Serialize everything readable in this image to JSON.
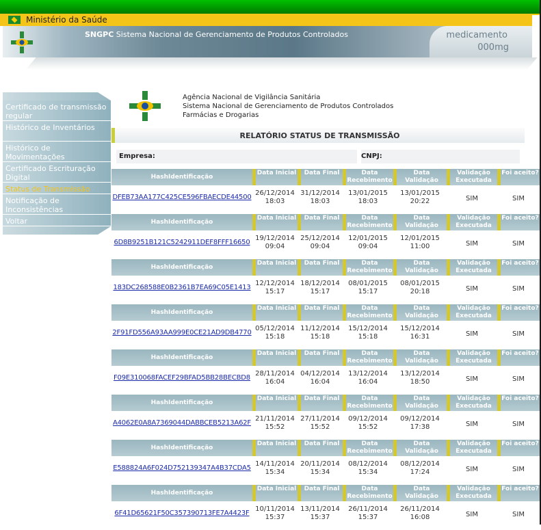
{
  "ministry": {
    "title": "Ministério da Saúde"
  },
  "banner": {
    "system_abbr": "SNGPC",
    "system_name": "Sistema Nacional de Gerenciamento de Produtos Controlados",
    "product_line1": "medicamento",
    "product_line2": "000mg"
  },
  "sidebar": {
    "items": [
      {
        "label": "Certificado de transmissão regular",
        "active": false
      },
      {
        "label": "Histórico de Inventários",
        "active": false
      },
      {
        "label": "Histórico de Movimentações",
        "active": false
      },
      {
        "label": "Certificado Escrituração Digital",
        "active": false
      },
      {
        "label": "Status de Transmissão",
        "active": true
      },
      {
        "label": "Notificação de Inconsistências",
        "active": false
      },
      {
        "label": "Voltar",
        "active": false
      }
    ]
  },
  "agency": {
    "line1": "Agência Nacional de Vigilância Sanitária",
    "line2": "Sistema Nacional de Gerenciamento de Produtos Controlados",
    "line3": "Farmácias e Drogarias"
  },
  "report": {
    "title": "RELATÓRIO STATUS DE TRANSMISSÃO",
    "company_label": "Empresa:",
    "cnpj_label": "CNPJ:"
  },
  "table": {
    "headers": {
      "hash": "HashIdentificação",
      "data_inicial": "Data Inicial",
      "data_final": "Data Final",
      "data_recebimento": "Data Recebimento",
      "data_validacao": "Data Validação",
      "validacao_executada": "Validação Executada",
      "foi_aceito": "Foi aceito?"
    },
    "rows": [
      {
        "hash": "DFEB73AA177C425CE596FBAECDE44500",
        "ini_d": "26/12/2014",
        "ini_t": "18:03",
        "fin_d": "31/12/2014",
        "fin_t": "18:03",
        "rec_d": "13/01/2015",
        "rec_t": "18:03",
        "val_d": "13/01/2015",
        "val_t": "20:22",
        "validada": "SIM",
        "aceito": "SIM"
      },
      {
        "hash": "6D8B9251B121C5242911DEF8FFF16650",
        "ini_d": "19/12/2014",
        "ini_t": "09:04",
        "fin_d": "25/12/2014",
        "fin_t": "09:04",
        "rec_d": "12/01/2015",
        "rec_t": "09:04",
        "val_d": "12/01/2015",
        "val_t": "11:00",
        "validada": "SIM",
        "aceito": "SIM"
      },
      {
        "hash": "183DC268588E0B2361B7EA69C05E1413",
        "ini_d": "12/12/2014",
        "ini_t": "15:17",
        "fin_d": "18/12/2014",
        "fin_t": "15:17",
        "rec_d": "08/01/2015",
        "rec_t": "15:17",
        "val_d": "08/01/2015",
        "val_t": "20:18",
        "validada": "SIM",
        "aceito": "SIM"
      },
      {
        "hash": "2F91FD556A93AA999E0CE21AD9DB4770",
        "ini_d": "05/12/2014",
        "ini_t": "15:18",
        "fin_d": "11/12/2014",
        "fin_t": "15:18",
        "rec_d": "15/12/2014",
        "rec_t": "15:18",
        "val_d": "15/12/2014",
        "val_t": "16:31",
        "validada": "SIM",
        "aceito": "SIM"
      },
      {
        "hash": "F09E310068FACEF29BFAD5BB28BECBD8",
        "ini_d": "28/11/2014",
        "ini_t": "16:04",
        "fin_d": "04/12/2014",
        "fin_t": "16:04",
        "rec_d": "13/12/2014",
        "rec_t": "16:04",
        "val_d": "13/12/2014",
        "val_t": "18:50",
        "validada": "SIM",
        "aceito": "SIM"
      },
      {
        "hash": "A4062E0A8A7369044DABBCEB5213A62F",
        "ini_d": "21/11/2014",
        "ini_t": "15:52",
        "fin_d": "27/11/2014",
        "fin_t": "15:52",
        "rec_d": "09/12/2014",
        "rec_t": "15:52",
        "val_d": "09/12/2014",
        "val_t": "17:38",
        "validada": "SIM",
        "aceito": "SIM"
      },
      {
        "hash": "E588824A6F024D752139347A4B37CDA5",
        "ini_d": "14/11/2014",
        "ini_t": "15:34",
        "fin_d": "20/11/2014",
        "fin_t": "15:34",
        "rec_d": "08/12/2014",
        "rec_t": "15:34",
        "val_d": "08/12/2014",
        "val_t": "17:24",
        "validada": "SIM",
        "aceito": "SIM"
      },
      {
        "hash": "6F41D65621F50C357390713FE7A4423F",
        "ini_d": "10/11/2014",
        "ini_t": "15:37",
        "fin_d": "13/11/2014",
        "fin_t": "15:37",
        "rec_d": "26/11/2014",
        "rec_t": "15:37",
        "val_d": "26/11/2014",
        "val_t": "16:08",
        "validada": "SIM",
        "aceito": "SIM"
      }
    ]
  }
}
